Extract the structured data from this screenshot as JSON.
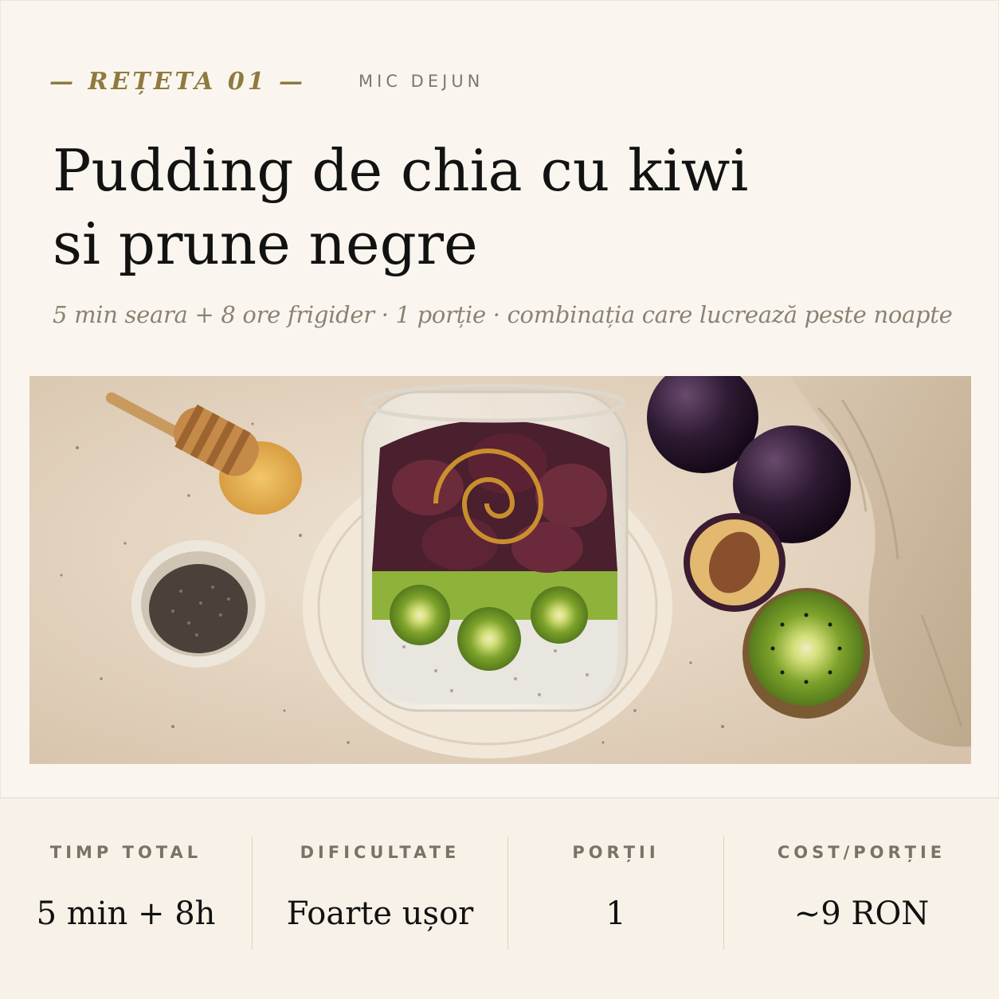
{
  "header": {
    "recipe_label": "— REȚETA 01 —",
    "category": "MIC DEJUN"
  },
  "title_lines": [
    "Pudding de chia cu kiwi",
    "si prune negre"
  ],
  "subtitle": "5 min seara + 8 ore frigider · 1 porție · combinația care lucrează peste noapte",
  "stats": [
    {
      "label": "TIMP TOTAL",
      "value": "5 min + 8h"
    },
    {
      "label": "DIFICULTATE",
      "value": "Foarte ușor"
    },
    {
      "label": "PORȚII",
      "value": "1"
    },
    {
      "label": "COST/PORȚIE",
      "value": "~9 RON"
    }
  ],
  "colors": {
    "accent": "#8f7a3f",
    "background": "#faf6ef",
    "text": "#121212",
    "muted": "#8b8273"
  }
}
